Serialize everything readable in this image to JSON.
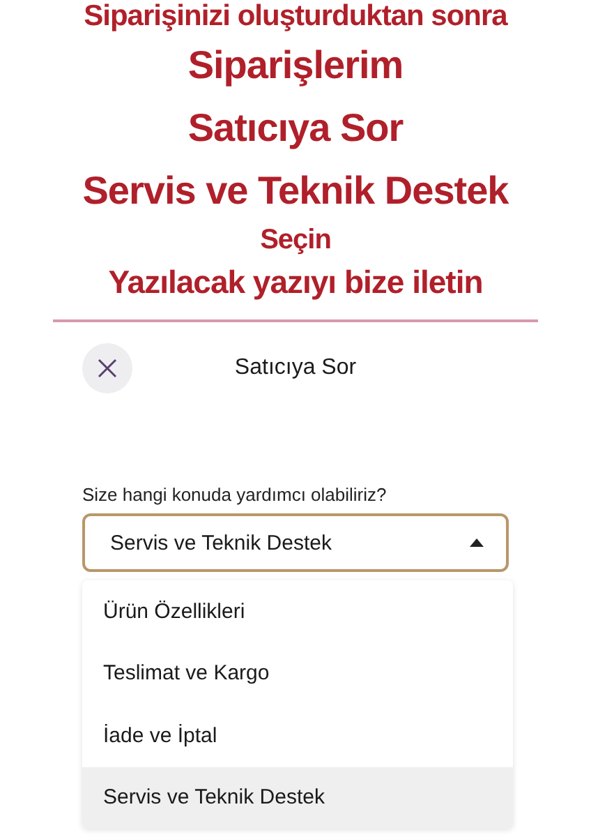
{
  "instructions": [
    {
      "text": "Siparişinizi oluşturduktan sonra",
      "kind": "note"
    },
    {
      "text": "Siparişlerim",
      "kind": "step"
    },
    {
      "text": "Satıcıya Sor",
      "kind": "step"
    },
    {
      "text": "Servis ve Teknik Destek",
      "kind": "step"
    },
    {
      "text": "Seçin",
      "kind": "minor"
    },
    {
      "text": "Yazılacak yazıyı bize iletin",
      "kind": "note"
    }
  ],
  "dialog": {
    "title": "Satıcıya Sor"
  },
  "form": {
    "label": "Size hangi konuda yardımcı olabiliriz?",
    "value": "Servis ve Teknik Destek",
    "expanded": true
  },
  "options": [
    {
      "label": "Ürün Özellikleri",
      "selected": false
    },
    {
      "label": "Teslimat ve Kargo",
      "selected": false
    },
    {
      "label": "İade ve İptal",
      "selected": false
    },
    {
      "label": "Servis ve Teknik Destek",
      "selected": true
    }
  ]
}
